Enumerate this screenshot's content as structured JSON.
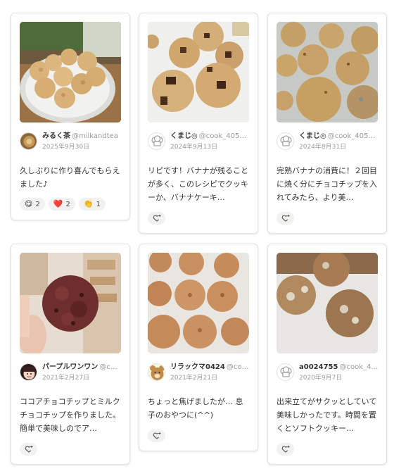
{
  "cards": [
    {
      "user": "みるく茶",
      "handle": "@milkandtea",
      "date": "2025年9月30日",
      "comment": "久しぶりに作り喜んでもらえました♪",
      "reactions": [
        {
          "emoji": "😋",
          "count": "2"
        },
        {
          "emoji": "❤️",
          "count": "2"
        },
        {
          "emoji": "👏",
          "count": "1"
        }
      ]
    },
    {
      "user": "くまじ◎",
      "handle": "@cook_405…",
      "date": "2024年9月13日",
      "comment": "リピです！バナナが残ることが多く、このレシピでクッキーか、バナナケーキ…"
    },
    {
      "user": "くまじ◎",
      "handle": "@cook_405…",
      "date": "2024年8月31日",
      "comment": "完熟バナナの消費に！２回目に焼く分にチョコチップを入れてみたら、より美…"
    },
    {
      "user": "パープルワンワン",
      "handle": "@c…",
      "date": "2021年2月27日",
      "comment": "ココアチョコチップとミルクチョコチップを作りました。簡単で美味しのでア…"
    },
    {
      "user": "リラックマ0424",
      "handle": "@co…",
      "date": "2021年2月21日",
      "comment": "ちょっと焦げましたが… 息子のおやつに(^^)"
    },
    {
      "user": "a0024755",
      "handle": "@cook_4…",
      "date": "2020年9月7日",
      "comment": "出来立てがサクッとしていて美味しかったです。時間を置くとソフトクッキー…"
    }
  ],
  "icons": {
    "reaction_button": "heart-plus-icon",
    "default_avatar": "chef-hat-icon"
  },
  "colors": {
    "chip_bg": "#f1f1ef",
    "card_border": "#e2e2e0",
    "muted_text": "#9a9a9a"
  }
}
